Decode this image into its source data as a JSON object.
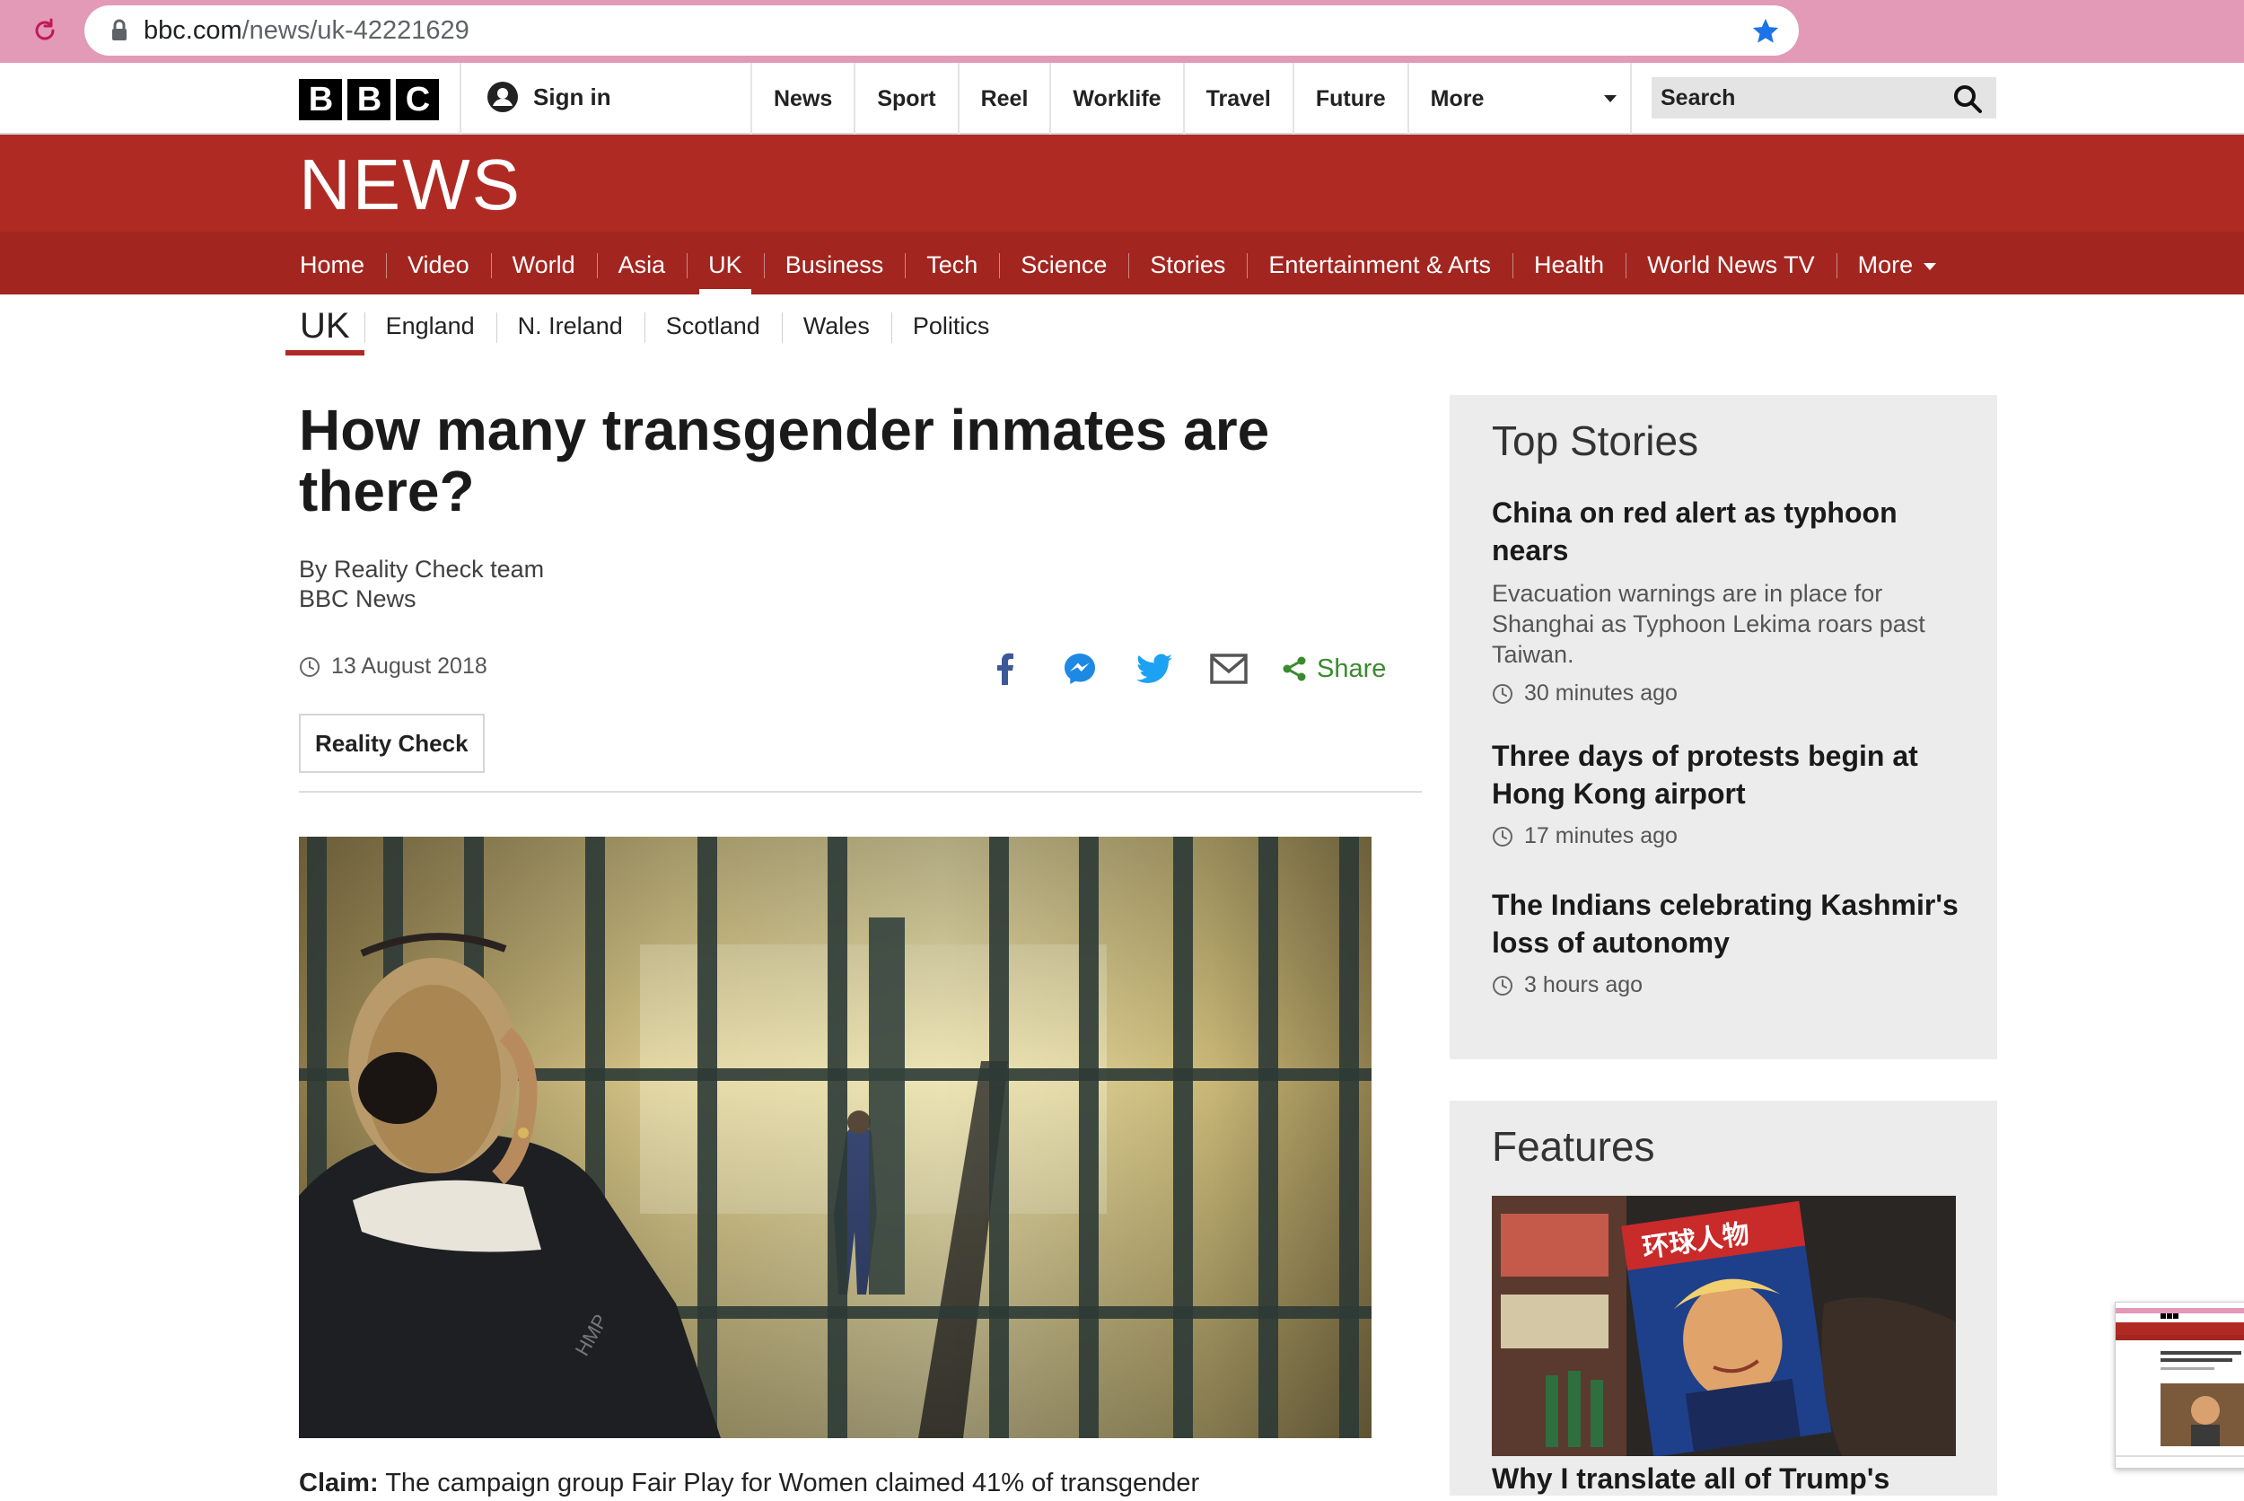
{
  "browser": {
    "url_domain": "bbc.com",
    "url_path": "/news/uk-42221629"
  },
  "topbar": {
    "logo_letters": [
      "B",
      "B",
      "C"
    ],
    "signin_label": "Sign in",
    "nav": [
      "News",
      "Sport",
      "Reel",
      "Worklife",
      "Travel",
      "Future",
      "More"
    ],
    "search_placeholder": "Search"
  },
  "news_banner": {
    "title": "NEWS"
  },
  "section_nav": {
    "items": [
      "Home",
      "Video",
      "World",
      "Asia",
      "UK",
      "Business",
      "Tech",
      "Science",
      "Stories",
      "Entertainment & Arts",
      "Health",
      "World News TV",
      "More"
    ],
    "active": "UK"
  },
  "sub_nav": {
    "current": "UK",
    "items": [
      "England",
      "N. Ireland",
      "Scotland",
      "Wales",
      "Politics"
    ]
  },
  "article": {
    "headline": "How many transgender inmates are there?",
    "byline_author": "By Reality Check team",
    "byline_org": "BBC News",
    "date": "13 August 2018",
    "share_label": "Share",
    "share_targets": [
      "facebook-icon",
      "messenger-icon",
      "twitter-icon",
      "email-icon"
    ],
    "tag": "Reality Check",
    "caption_lead": "Claim:",
    "caption_text": "The campaign group Fair Play for Women claimed 41% of transgender"
  },
  "top_stories": {
    "title": "Top Stories",
    "items": [
      {
        "headline": "China on red alert as typhoon nears",
        "summary": "Evacuation warnings are in place for Shanghai as Typhoon Lekima roars past Taiwan.",
        "time": "30 minutes ago"
      },
      {
        "headline": "Three days of protests begin at Hong Kong airport",
        "summary": "",
        "time": "17 minutes ago"
      },
      {
        "headline": "The Indians celebrating Kashmir's loss of autonomy",
        "summary": "",
        "time": "3 hours ago"
      }
    ]
  },
  "features": {
    "title": "Features",
    "first_headline": "Why I translate all of Trump's",
    "magazine_title": "环球人物"
  },
  "colors": {
    "bbc_red": "#b02a24",
    "nav_red": "#a3251f",
    "share_green": "#3a8a2e",
    "browser_bar": "#e29ab6"
  }
}
